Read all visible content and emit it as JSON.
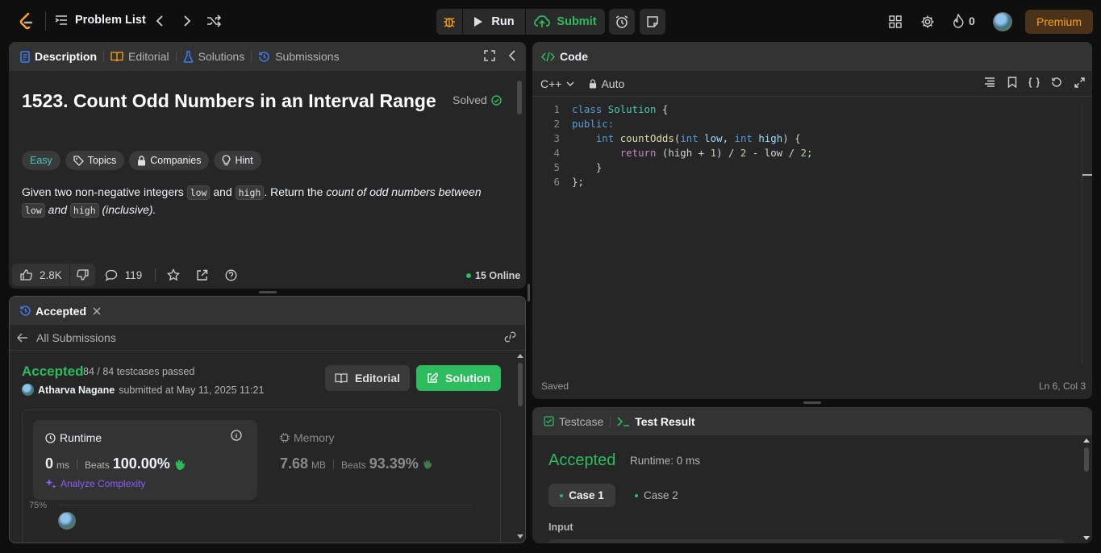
{
  "topbar": {
    "problem_list": "Problem List",
    "run": "Run",
    "submit": "Submit",
    "streak": "0",
    "premium": "Premium"
  },
  "description": {
    "tabs": [
      "Description",
      "Editorial",
      "Solutions",
      "Submissions"
    ],
    "title": "1523. Count Odd Numbers in an Interval Range",
    "solved": "Solved",
    "difficulty": "Easy",
    "chips": [
      "Topics",
      "Companies",
      "Hint"
    ],
    "text": {
      "p1": "Given two non-negative integers",
      "low": "low",
      "and": "and",
      "high": ". Return the",
      "high_code": "high",
      "italic1": "count of odd numbers between",
      "and2": "and",
      "high2": "high",
      "inclusive": "(inclusive)."
    },
    "likes": "2.8K",
    "comments": "119",
    "online": "15 Online"
  },
  "submission": {
    "tab": "Accepted",
    "back": "All Submissions",
    "status": "Accepted",
    "testcases": "84 / 84 testcases passed",
    "author": "Atharva Nagane",
    "submitted": "submitted at May 11, 2025 11:21",
    "editorial_btn": "Editorial",
    "solution_btn": "Solution",
    "runtime_label": "Runtime",
    "runtime_value": "0",
    "runtime_unit": "ms",
    "beats": "Beats",
    "runtime_beats": "100.00%",
    "analyze": "Analyze Complexity",
    "memory_label": "Memory",
    "memory_value": "7.68",
    "memory_unit": "MB",
    "memory_beats": "93.39%",
    "chart_tick": "75%"
  },
  "code": {
    "title": "Code",
    "language": "C++",
    "mode": "Auto",
    "lines": [
      [
        {
          "t": "class",
          "c": "kw"
        },
        {
          "t": " ",
          "c": "tx"
        },
        {
          "t": "Solution",
          "c": "ty"
        },
        {
          "t": " {",
          "c": "tx"
        }
      ],
      [
        {
          "t": "public:",
          "c": "kw"
        }
      ],
      [
        {
          "t": "    ",
          "c": "tx"
        },
        {
          "t": "int",
          "c": "kw"
        },
        {
          "t": " ",
          "c": "tx"
        },
        {
          "t": "countOdds",
          "c": "fn"
        },
        {
          "t": "(",
          "c": "tx"
        },
        {
          "t": "int",
          "c": "kw"
        },
        {
          "t": " ",
          "c": "tx"
        },
        {
          "t": "low",
          "c": "pm"
        },
        {
          "t": ", ",
          "c": "tx"
        },
        {
          "t": "int",
          "c": "kw"
        },
        {
          "t": " ",
          "c": "tx"
        },
        {
          "t": "high",
          "c": "pm"
        },
        {
          "t": ") {",
          "c": "tx"
        }
      ],
      [
        {
          "t": "        ",
          "c": "tx"
        },
        {
          "t": "return",
          "c": "pc"
        },
        {
          "t": " (high + ",
          "c": "tx"
        },
        {
          "t": "1",
          "c": "nm"
        },
        {
          "t": ") / ",
          "c": "tx"
        },
        {
          "t": "2",
          "c": "nm"
        },
        {
          "t": " - low / ",
          "c": "tx"
        },
        {
          "t": "2",
          "c": "nm"
        },
        {
          "t": ";",
          "c": "tx"
        }
      ],
      [
        {
          "t": "    }",
          "c": "tx"
        }
      ],
      [
        {
          "t": "};",
          "c": "tx"
        }
      ]
    ],
    "status": "Saved",
    "cursor": "Ln 6, Col 3"
  },
  "result": {
    "tabs": [
      "Testcase",
      "Test Result"
    ],
    "status": "Accepted",
    "runtime": "Runtime: 0 ms",
    "cases": [
      "Case 1",
      "Case 2"
    ],
    "input_label": "Input"
  }
}
